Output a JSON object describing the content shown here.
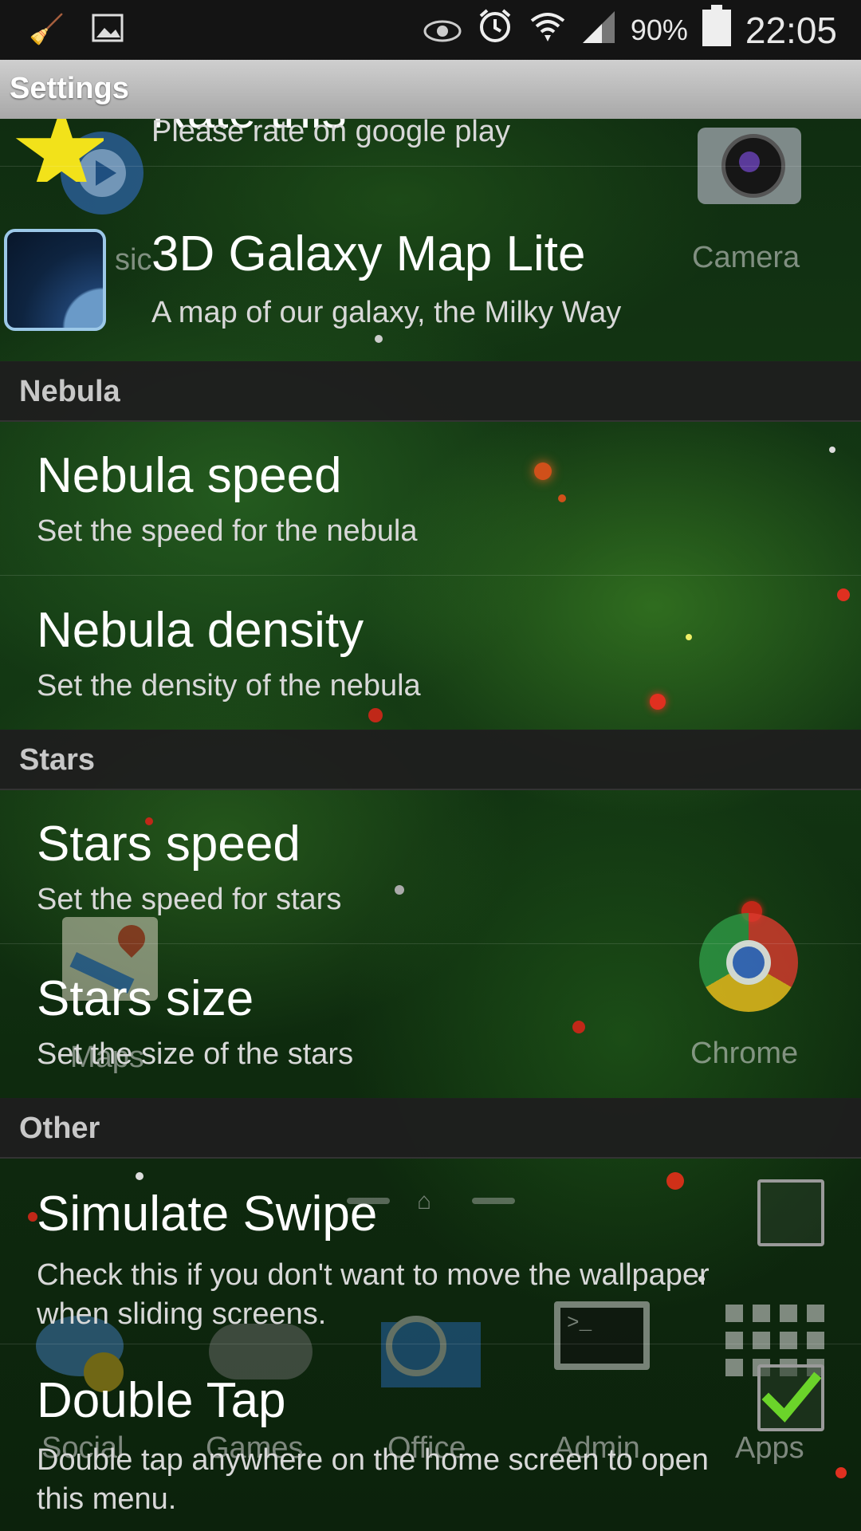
{
  "status_bar": {
    "left_icons": [
      "broom-icon",
      "image-icon"
    ],
    "right_icons": [
      "eye-icon",
      "alarm-icon",
      "wifi-icon",
      "signal-icon",
      "battery-icon"
    ],
    "battery_percent": "90%",
    "time": "22:05"
  },
  "title_bar": {
    "title": "Settings"
  },
  "preferences": {
    "rate": {
      "title": "Rate this",
      "summary": "Please rate on google play"
    },
    "galaxy": {
      "title": "3D Galaxy Map Lite",
      "summary": "A map of our galaxy, the Milky Way"
    },
    "cat_nebula": "Nebula",
    "nebula_speed": {
      "title": "Nebula speed",
      "summary": "Set the speed for the nebula"
    },
    "nebula_density": {
      "title": "Nebula density",
      "summary": "Set the density of the nebula"
    },
    "cat_stars": "Stars",
    "stars_speed": {
      "title": "Stars speed",
      "summary": "Set the speed for stars"
    },
    "stars_size": {
      "title": "Stars size",
      "summary": "Set the size of the stars"
    },
    "cat_other": "Other",
    "simulate_swipe": {
      "title": "Simulate Swipe",
      "summary": "Check this if you don't want to move the wallpaper when sliding screens.",
      "checked": false
    },
    "double_tap": {
      "title": "Double Tap",
      "summary": "Double tap anywhere on the home screen to open this menu.",
      "checked": true
    }
  },
  "home_screen": {
    "labels": {
      "music": "sic",
      "camera": "Camera",
      "maps": "Maps",
      "chrome": "Chrome",
      "social": "Social",
      "games": "Games",
      "office": "Office",
      "admin": "Admin",
      "apps": "Apps"
    }
  },
  "colors": {
    "category_bg": "#1e1e1e",
    "checkmark": "#6bd42a",
    "title_bar": "#b8b8b8"
  }
}
